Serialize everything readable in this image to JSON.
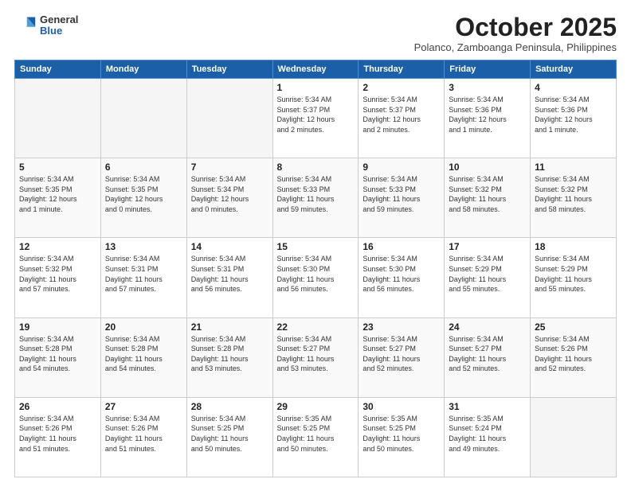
{
  "header": {
    "logo_general": "General",
    "logo_blue": "Blue",
    "month_title": "October 2025",
    "location": "Polanco, Zamboanga Peninsula, Philippines"
  },
  "days_of_week": [
    "Sunday",
    "Monday",
    "Tuesday",
    "Wednesday",
    "Thursday",
    "Friday",
    "Saturday"
  ],
  "weeks": [
    [
      {
        "day": "",
        "text": ""
      },
      {
        "day": "",
        "text": ""
      },
      {
        "day": "",
        "text": ""
      },
      {
        "day": "1",
        "text": "Sunrise: 5:34 AM\nSunset: 5:37 PM\nDaylight: 12 hours\nand 2 minutes."
      },
      {
        "day": "2",
        "text": "Sunrise: 5:34 AM\nSunset: 5:37 PM\nDaylight: 12 hours\nand 2 minutes."
      },
      {
        "day": "3",
        "text": "Sunrise: 5:34 AM\nSunset: 5:36 PM\nDaylight: 12 hours\nand 1 minute."
      },
      {
        "day": "4",
        "text": "Sunrise: 5:34 AM\nSunset: 5:36 PM\nDaylight: 12 hours\nand 1 minute."
      }
    ],
    [
      {
        "day": "5",
        "text": "Sunrise: 5:34 AM\nSunset: 5:35 PM\nDaylight: 12 hours\nand 1 minute."
      },
      {
        "day": "6",
        "text": "Sunrise: 5:34 AM\nSunset: 5:35 PM\nDaylight: 12 hours\nand 0 minutes."
      },
      {
        "day": "7",
        "text": "Sunrise: 5:34 AM\nSunset: 5:34 PM\nDaylight: 12 hours\nand 0 minutes."
      },
      {
        "day": "8",
        "text": "Sunrise: 5:34 AM\nSunset: 5:33 PM\nDaylight: 11 hours\nand 59 minutes."
      },
      {
        "day": "9",
        "text": "Sunrise: 5:34 AM\nSunset: 5:33 PM\nDaylight: 11 hours\nand 59 minutes."
      },
      {
        "day": "10",
        "text": "Sunrise: 5:34 AM\nSunset: 5:32 PM\nDaylight: 11 hours\nand 58 minutes."
      },
      {
        "day": "11",
        "text": "Sunrise: 5:34 AM\nSunset: 5:32 PM\nDaylight: 11 hours\nand 58 minutes."
      }
    ],
    [
      {
        "day": "12",
        "text": "Sunrise: 5:34 AM\nSunset: 5:32 PM\nDaylight: 11 hours\nand 57 minutes."
      },
      {
        "day": "13",
        "text": "Sunrise: 5:34 AM\nSunset: 5:31 PM\nDaylight: 11 hours\nand 57 minutes."
      },
      {
        "day": "14",
        "text": "Sunrise: 5:34 AM\nSunset: 5:31 PM\nDaylight: 11 hours\nand 56 minutes."
      },
      {
        "day": "15",
        "text": "Sunrise: 5:34 AM\nSunset: 5:30 PM\nDaylight: 11 hours\nand 56 minutes."
      },
      {
        "day": "16",
        "text": "Sunrise: 5:34 AM\nSunset: 5:30 PM\nDaylight: 11 hours\nand 56 minutes."
      },
      {
        "day": "17",
        "text": "Sunrise: 5:34 AM\nSunset: 5:29 PM\nDaylight: 11 hours\nand 55 minutes."
      },
      {
        "day": "18",
        "text": "Sunrise: 5:34 AM\nSunset: 5:29 PM\nDaylight: 11 hours\nand 55 minutes."
      }
    ],
    [
      {
        "day": "19",
        "text": "Sunrise: 5:34 AM\nSunset: 5:28 PM\nDaylight: 11 hours\nand 54 minutes."
      },
      {
        "day": "20",
        "text": "Sunrise: 5:34 AM\nSunset: 5:28 PM\nDaylight: 11 hours\nand 54 minutes."
      },
      {
        "day": "21",
        "text": "Sunrise: 5:34 AM\nSunset: 5:28 PM\nDaylight: 11 hours\nand 53 minutes."
      },
      {
        "day": "22",
        "text": "Sunrise: 5:34 AM\nSunset: 5:27 PM\nDaylight: 11 hours\nand 53 minutes."
      },
      {
        "day": "23",
        "text": "Sunrise: 5:34 AM\nSunset: 5:27 PM\nDaylight: 11 hours\nand 52 minutes."
      },
      {
        "day": "24",
        "text": "Sunrise: 5:34 AM\nSunset: 5:27 PM\nDaylight: 11 hours\nand 52 minutes."
      },
      {
        "day": "25",
        "text": "Sunrise: 5:34 AM\nSunset: 5:26 PM\nDaylight: 11 hours\nand 52 minutes."
      }
    ],
    [
      {
        "day": "26",
        "text": "Sunrise: 5:34 AM\nSunset: 5:26 PM\nDaylight: 11 hours\nand 51 minutes."
      },
      {
        "day": "27",
        "text": "Sunrise: 5:34 AM\nSunset: 5:26 PM\nDaylight: 11 hours\nand 51 minutes."
      },
      {
        "day": "28",
        "text": "Sunrise: 5:34 AM\nSunset: 5:25 PM\nDaylight: 11 hours\nand 50 minutes."
      },
      {
        "day": "29",
        "text": "Sunrise: 5:35 AM\nSunset: 5:25 PM\nDaylight: 11 hours\nand 50 minutes."
      },
      {
        "day": "30",
        "text": "Sunrise: 5:35 AM\nSunset: 5:25 PM\nDaylight: 11 hours\nand 50 minutes."
      },
      {
        "day": "31",
        "text": "Sunrise: 5:35 AM\nSunset: 5:24 PM\nDaylight: 11 hours\nand 49 minutes."
      },
      {
        "day": "",
        "text": ""
      }
    ]
  ]
}
